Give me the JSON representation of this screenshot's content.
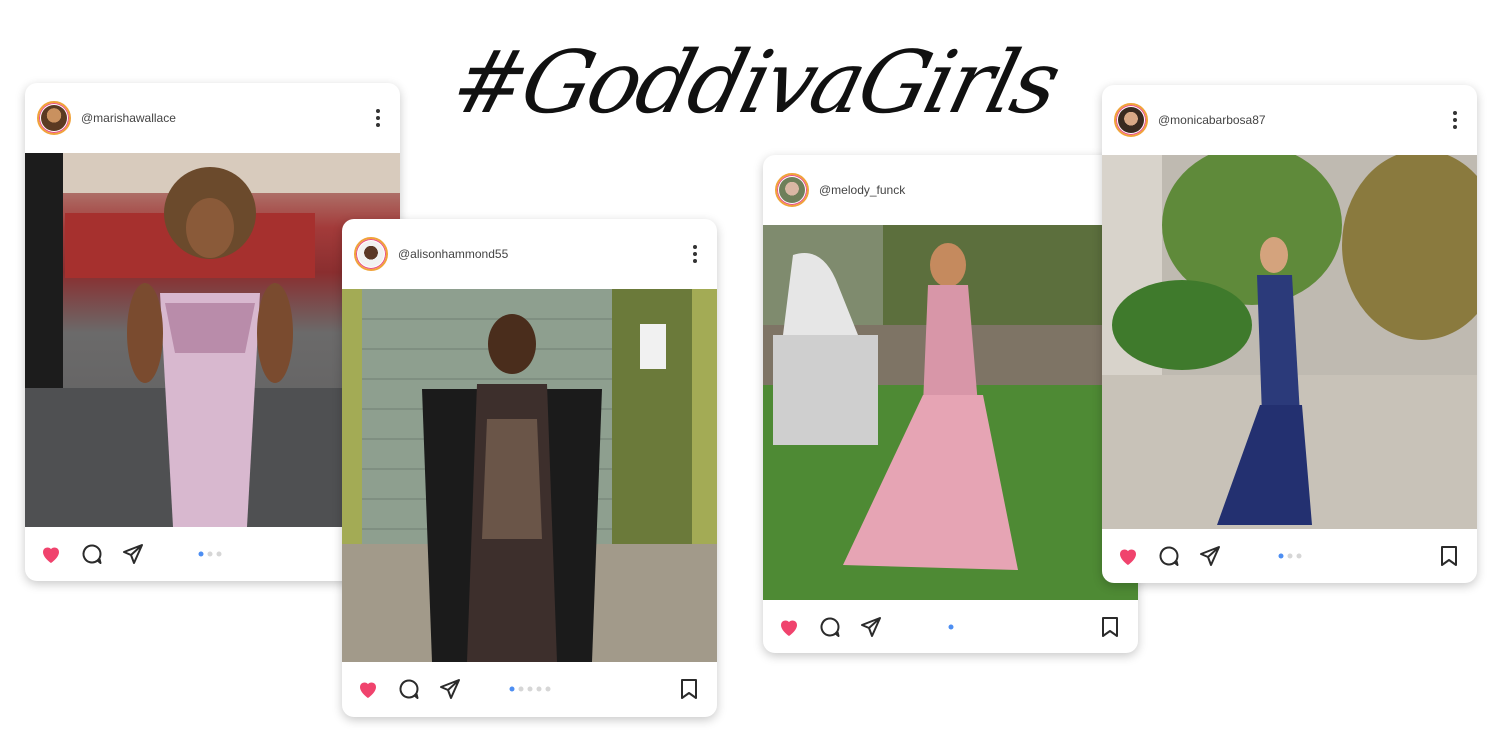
{
  "hashtag": "#GoddivaGirls",
  "colors": {
    "like": "#f0436d",
    "active_dot": "#4d8ef2",
    "inactive_dot": "#d6d6d6",
    "icon": "#2b2b2b"
  },
  "posts": [
    {
      "handle": "@marishawallace",
      "slides": 3,
      "active": 0,
      "icons": [
        "heart-icon",
        "comment-icon",
        "share-icon"
      ]
    },
    {
      "handle": "@alisonhammond55",
      "slides": 5,
      "active": 0,
      "icons": [
        "heart-icon",
        "comment-icon",
        "share-icon",
        "bookmark-icon"
      ]
    },
    {
      "handle": "@melody_funck",
      "slides": 1,
      "active": 0,
      "icons": [
        "heart-icon",
        "comment-icon",
        "share-icon",
        "bookmark-icon"
      ]
    },
    {
      "handle": "@monicabarbosa87",
      "slides": 3,
      "active": 0,
      "icons": [
        "heart-icon",
        "comment-icon",
        "share-icon",
        "bookmark-icon"
      ]
    }
  ]
}
